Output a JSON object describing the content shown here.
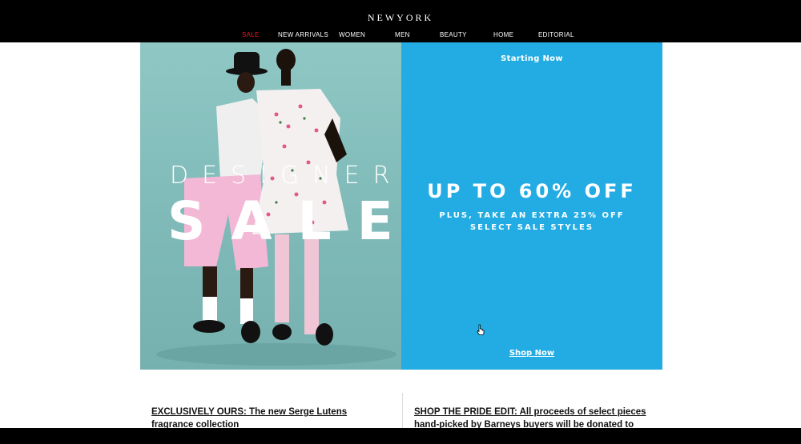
{
  "header": {
    "logo": "NEWYORK",
    "nav": [
      {
        "label": "SALE"
      },
      {
        "label": "NEW ARRIVALS"
      },
      {
        "label": "WOMEN"
      },
      {
        "label": "MEN"
      },
      {
        "label": "BEAUTY"
      },
      {
        "label": "HOME"
      },
      {
        "label": "EDITORIAL"
      }
    ]
  },
  "hero": {
    "image_title_line1": "DESIGNER",
    "image_title_line2": "SALE",
    "starting": "Starting Now",
    "headline": "UP TO 60% OFF",
    "subheadline": "PLUS, TAKE AN EXTRA 25% OFF SELECT SALE STYLES",
    "cta": "Shop Now"
  },
  "promos": [
    {
      "text": "EXCLUSIVELY OURS: The new Serge Lutens fragrance collection"
    },
    {
      "text": "SHOP THE PRIDE EDIT: All proceeds of select pieces hand-picked by Barneys buyers will be donated to The Center"
    }
  ],
  "colors": {
    "sale_nav": "#e11b22",
    "hero_blue": "#22ace3",
    "hero_teal": "#7fbab8"
  }
}
